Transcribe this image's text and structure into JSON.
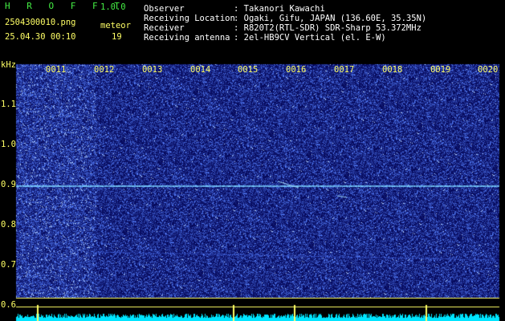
{
  "header": {
    "app_title": "H R O F F T",
    "version": "1.0.0",
    "filename": "2504300010.png",
    "datetime": "25.04.30 00:10",
    "meteor_label": "meteor",
    "meteor_count": "19",
    "info": [
      {
        "label": "Observer",
        "value": ": Takanori Kawachi"
      },
      {
        "label": "Receiving Location",
        "value": ": Ogaki, Gifu, JAPAN (136.60E, 35.35N)"
      },
      {
        "label": "Receiver",
        "value": ": R820T2(RTL-SDR) SDR-Sharp 53.372MHz"
      },
      {
        "label": "Receiving antenna",
        "value": ": 2el-HB9CV Vertical (el. E-W)"
      }
    ]
  },
  "axis": {
    "unit": "kHz",
    "time_ticks": [
      "0011",
      "0012",
      "0013",
      "0014",
      "0015",
      "0016",
      "0017",
      "0018",
      "0019",
      "0020"
    ],
    "freq_ticks": [
      "1.1",
      "1.0",
      "0.9",
      "0.8",
      "0.7",
      "0.6"
    ]
  },
  "colors": {
    "background": "#000000",
    "spectrogram_base": "#05087a",
    "carrier": "#7ad0ff",
    "grid": "#ffff66",
    "level_trace": "#00e5ff"
  }
}
